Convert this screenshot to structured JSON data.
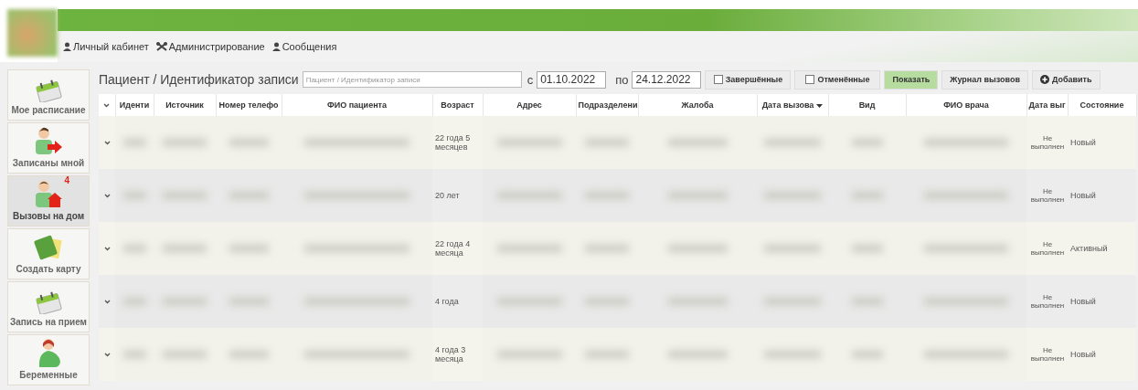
{
  "nav": [
    {
      "label": "Личный кабинет",
      "kind": "user"
    },
    {
      "label": "Администрирование",
      "kind": "tools"
    },
    {
      "label": "Сообщения",
      "kind": "user"
    }
  ],
  "sidebar": {
    "items": [
      {
        "label": "Мое расписание",
        "kind": "calendar",
        "selected": false
      },
      {
        "label": "Записаны мной",
        "kind": "referral",
        "selected": false
      },
      {
        "label": "Вызовы на дом",
        "kind": "house-call",
        "selected": true,
        "badge": "4"
      },
      {
        "label": "Создать карту",
        "kind": "card",
        "selected": false
      },
      {
        "label": "Запись на прием",
        "kind": "calendar",
        "selected": false
      },
      {
        "label": "Беременные",
        "kind": "pregnant",
        "selected": false
      }
    ]
  },
  "filter": {
    "label": "Пациент / Идентификатор записи",
    "placeholder": "Пациент / Идентификатор записи",
    "from_label": "с",
    "from": "01.10.2022",
    "to_label": "по",
    "to": "24.12.2022",
    "checkboxes": [
      {
        "label": "Завершённые",
        "checked": false
      },
      {
        "label": "Отменённые",
        "checked": false
      }
    ],
    "buttons": [
      {
        "label": "Показать",
        "kind": "primary"
      },
      {
        "label": "Журнал вызовов",
        "kind": "plain"
      },
      {
        "label": "Добавить",
        "kind": "add"
      }
    ]
  },
  "table": {
    "columns": [
      {
        "label": "Иденти",
        "sorted": false
      },
      {
        "label": "Источник",
        "sorted": false
      },
      {
        "label": "Номер телефо",
        "sorted": false
      },
      {
        "label": "ФИО пациента",
        "sorted": false
      },
      {
        "label": "Возраст",
        "sorted": false
      },
      {
        "label": "Адрес",
        "sorted": false
      },
      {
        "label": "Подразделени",
        "sorted": false
      },
      {
        "label": "Жалоба",
        "sorted": false
      },
      {
        "label": "Дата вызова",
        "sorted": true
      },
      {
        "label": "Вид",
        "sorted": false
      },
      {
        "label": "ФИО врача",
        "sorted": false
      },
      {
        "label": "Дата выг",
        "sorted": false
      },
      {
        "label": "Состояние",
        "sorted": false
      }
    ],
    "rows": [
      {
        "age": "22 года 5 месяцев",
        "completion": "Не выполнен",
        "status": "Новый"
      },
      {
        "age": "20 лет",
        "completion": "Не выполнен",
        "status": "Новый"
      },
      {
        "age": "22 года 4 месяца",
        "completion": "Не выполнен",
        "status": "Активный"
      },
      {
        "age": "4 года",
        "completion": "Не выполнен",
        "status": "Новый"
      },
      {
        "age": "4 года 3 месяца",
        "completion": "Не выполнен",
        "status": "Новый"
      }
    ]
  }
}
